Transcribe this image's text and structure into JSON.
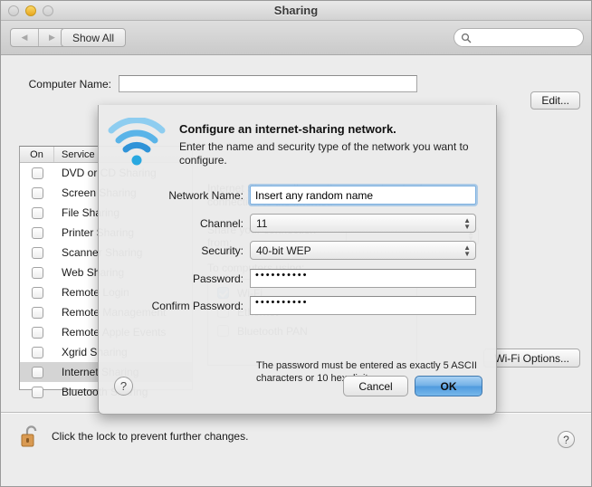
{
  "window": {
    "title": "Sharing",
    "traffic_lights": [
      "close",
      "minimize",
      "zoom"
    ]
  },
  "toolbar": {
    "back_icon": "◀",
    "forward_icon": "▶",
    "show_all_label": "Show All",
    "search_value": "",
    "search_placeholder": ""
  },
  "main": {
    "computer_name_label": "Computer Name:",
    "computer_name_value": "",
    "edit_label": "Edit...",
    "services_header": {
      "on": "On",
      "service": "Service"
    },
    "services": [
      {
        "label": "DVD or CD Sharing",
        "checked": false,
        "selected": false
      },
      {
        "label": "Screen Sharing",
        "checked": false,
        "selected": false
      },
      {
        "label": "File Sharing",
        "checked": false,
        "selected": false
      },
      {
        "label": "Printer Sharing",
        "checked": false,
        "selected": false
      },
      {
        "label": "Scanner Sharing",
        "checked": false,
        "selected": false
      },
      {
        "label": "Web Sharing",
        "checked": false,
        "selected": false
      },
      {
        "label": "Remote Login",
        "checked": false,
        "selected": false
      },
      {
        "label": "Remote Management",
        "checked": false,
        "selected": false
      },
      {
        "label": "Remote Apple Events",
        "checked": false,
        "selected": false
      },
      {
        "label": "Xgrid Sharing",
        "checked": false,
        "selected": false
      },
      {
        "label": "Internet Sharing",
        "checked": false,
        "selected": true
      },
      {
        "label": "Bluetooth Sharing",
        "checked": false,
        "selected": false
      }
    ],
    "detail_title": "Internet Sharing: Off",
    "detail_desc": "Internet Sharing allows other computers to share your connection to the Internet.",
    "share_label": "Share your connection from:",
    "share_value": "Wi-Fi",
    "ports_label": "To computers using:",
    "ports": [
      {
        "label": "Wi-Fi",
        "checked": true
      },
      {
        "label": "Ethernet",
        "checked": false
      },
      {
        "label": "Bluetooth PAN",
        "checked": false
      }
    ],
    "wifi_options_label": "Wi-Fi Options...",
    "lock_text": "Click the lock to prevent further changes.",
    "lock_icon": "unlocked-padlock-icon",
    "help_icon": "?"
  },
  "sheet": {
    "icon": "wifi-icon",
    "title": "Configure an internet-sharing network.",
    "subtitle": "Enter the name and security type of the network you want to configure.",
    "fields": {
      "network_name_label": "Network Name:",
      "network_name_value": "Insert any random name",
      "channel_label": "Channel:",
      "channel_value": "11",
      "security_label": "Security:",
      "security_value": "40-bit WEP",
      "password_label": "Password:",
      "password_value": "••••••••••",
      "confirm_label": "Confirm Password:",
      "confirm_value": "••••••••••"
    },
    "password_note": "The password must be entered as exactly 5 ASCII characters or 10 hex digits.",
    "help_label": "?",
    "cancel_label": "Cancel",
    "ok_label": "OK"
  },
  "colors": {
    "accent_blue": "#4f9ade",
    "focus_ring": "#7aafe0",
    "amber": "#e8a61c",
    "window_bg": "#ececec"
  }
}
